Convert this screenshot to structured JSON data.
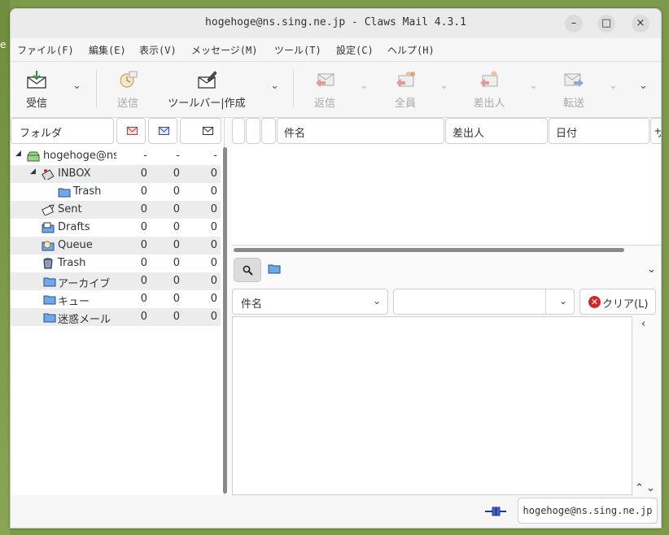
{
  "desktop": {
    "fragment": "e"
  },
  "window": {
    "title": "hogehoge@ns.sing.ne.jp - Claws Mail 4.3.1",
    "controls": {
      "minimize": "–",
      "maximize": "□",
      "close": "×"
    }
  },
  "menu": [
    "ファイル(F)",
    "編集(E)",
    "表示(V)",
    "メッセージ(M)",
    "ツール(T)",
    "設定(C)",
    "ヘルプ(H)"
  ],
  "toolbar": {
    "receive": "受信",
    "send": "送信",
    "compose": "ツールバー|作成",
    "reply": "返信",
    "reply_all": "全員",
    "reply_sender": "差出人",
    "forward": "転送",
    "dropdown_glyph": "⌄"
  },
  "folder_pane": {
    "header": "フォルダ",
    "rows": [
      {
        "name": "hogehoge@ns",
        "new": "-",
        "unread": "-",
        "total": "-"
      },
      {
        "name": "INBOX",
        "new": "0",
        "unread": "0",
        "total": "0"
      },
      {
        "name": "Trash",
        "new": "0",
        "unread": "0",
        "total": "0"
      },
      {
        "name": "Sent",
        "new": "0",
        "unread": "0",
        "total": "0"
      },
      {
        "name": "Drafts",
        "new": "0",
        "unread": "0",
        "total": "0"
      },
      {
        "name": "Queue",
        "new": "0",
        "unread": "0",
        "total": "0"
      },
      {
        "name": "Trash",
        "new": "0",
        "unread": "0",
        "total": "0"
      },
      {
        "name": "アーカイブ",
        "new": "0",
        "unread": "0",
        "total": "0"
      },
      {
        "name": "キュー",
        "new": "0",
        "unread": "0",
        "total": "0"
      },
      {
        "name": "迷惑メール",
        "new": "0",
        "unread": "0",
        "total": "0"
      }
    ]
  },
  "message_list": {
    "columns": {
      "subject": "件名",
      "from": "差出人",
      "date": "日付",
      "size": "サ"
    }
  },
  "search": {
    "field_select": "件名",
    "input_value": "",
    "clear_label": "クリア(L)"
  },
  "statusbar": {
    "account": "hogehoge@ns.sing.ne.jp"
  }
}
